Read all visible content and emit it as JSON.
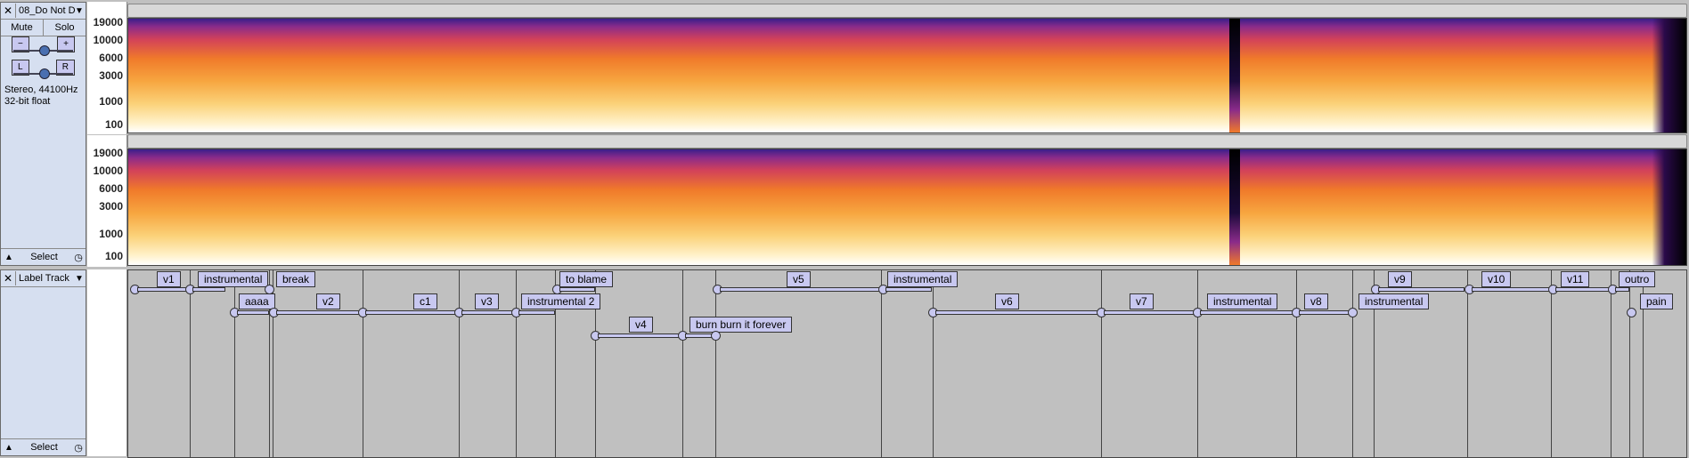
{
  "audio_track": {
    "name": "08_Do Not D",
    "mute": "Mute",
    "solo": "Solo",
    "gain_minus": "−",
    "gain_plus": "+",
    "pan_left": "L",
    "pan_right": "R",
    "info_line1": "Stereo, 44100Hz",
    "info_line2": "32-bit float",
    "select": "Select"
  },
  "freq_ticks": [
    "19000",
    "10000",
    "6000",
    "3000",
    "1000",
    "100"
  ],
  "label_track": {
    "name": "Label Track",
    "select": "Select"
  },
  "labels": {
    "l1": "v1",
    "l2": "instrumental",
    "l3": "break",
    "l4": "aaaa",
    "l5": "v2",
    "l6": "c1",
    "l7": "v3",
    "l8": "to blame",
    "l9": "instrumental 2",
    "l10": "v4",
    "l11": "burn burn it forever",
    "l12": "v5",
    "l13": "instrumental",
    "l14": "v6",
    "l15": "v7",
    "l16": "instrumental",
    "l17": "v8",
    "l18": "v9",
    "l19": "instrumental",
    "l20": "v10",
    "l21": "v11",
    "l22": "outro",
    "l23": "pain"
  }
}
